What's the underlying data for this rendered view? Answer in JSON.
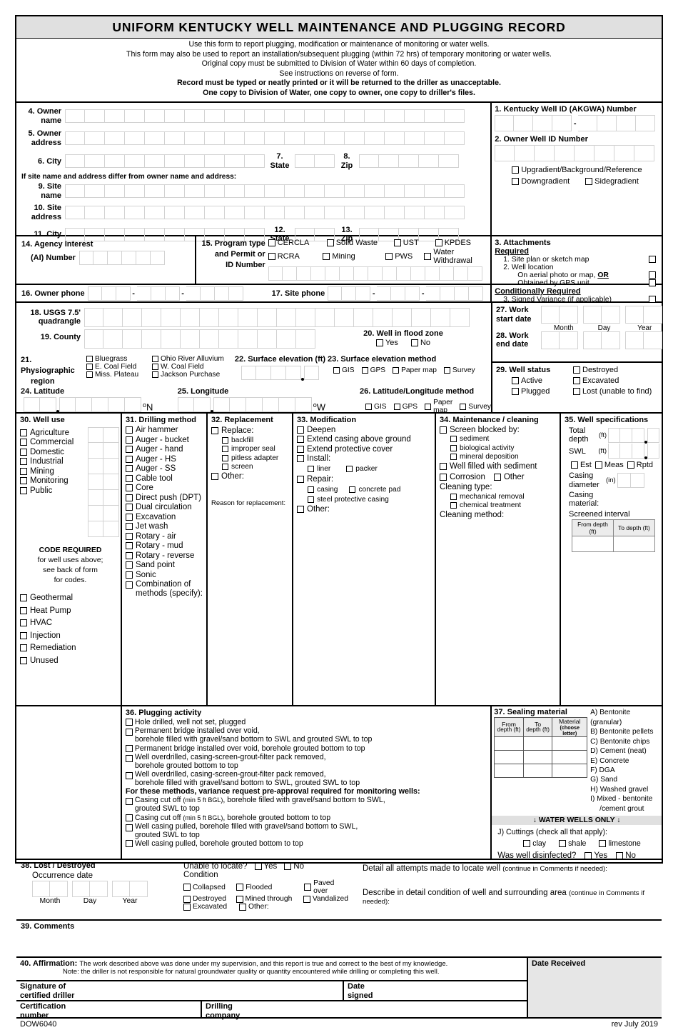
{
  "header": {
    "title": "UNIFORM KENTUCKY WELL MAINTENANCE AND PLUGGING RECORD",
    "lines": [
      "Use this form to report plugging, modification or maintenance of monitoring or water wells.",
      "This form may also be used to report an installation/subsequent plugging (within 72 hrs) of temporary monitoring or water wells.",
      "Original copy must be submitted to Division of Water within 60 days of completion.",
      "See instructions on reverse of form."
    ],
    "bold_lines": [
      "Record must be typed or neatly printed or it will be returned to the driller as unacceptable.",
      "One copy to Division of Water, one copy to owner, one copy to driller's files."
    ]
  },
  "owner": {
    "f4": "4. Owner",
    "f4b": "name",
    "f5": "5. Owner",
    "f5b": "address",
    "f6": "6. City",
    "f7": "7.",
    "f7b": "State",
    "f8": "8.",
    "f8b": "Zip",
    "note": "If site name and address differ from owner name and address:",
    "f9": "9. Site",
    "f9b": "name",
    "f10": "10. Site",
    "f10b": "address",
    "f11": "11. City",
    "f12": "12.",
    "f12b": "State",
    "f13": "13.",
    "f13b": "Zip"
  },
  "wellid": {
    "f1": "1.  Kentucky Well ID (AKGWA) Number",
    "f2": "2. Owner Well ID Number",
    "dash": "-",
    "gradients": [
      "Upgradient/Background/Reference",
      "Downgradient",
      "Sidegradient"
    ]
  },
  "attachments": {
    "title": "3. Attachments",
    "required": "Required",
    "item1": "1. Site plan or sketch map",
    "item2": "2. Well location",
    "item2a": "On aerial photo or map, ",
    "item2a_or": "OR",
    "item2b": "Obtained by GPS unit",
    "cond": "Conditionally Required",
    "item3": "3. Signed Variance (if applicable)"
  },
  "agency": {
    "f14": "14. Agency Interest",
    "f14b": "(AI) Number",
    "f15": "15. Program type",
    "f15b": "and Permit or",
    "f15c": "ID Number",
    "programs": [
      "CERCLA",
      "Solid Waste",
      "UST",
      "KPDES",
      "RCRA",
      "Mining",
      "PWS",
      "Water Withdrawal"
    ]
  },
  "phones": {
    "f16": "16. Owner phone",
    "f17": "17. Site phone",
    "dash": "-"
  },
  "location": {
    "f18": "18. USGS 7.5'",
    "f18b": "quadrangle",
    "f19": "19. County",
    "f20": "20. Well in flood zone",
    "yes": "Yes",
    "no": "No",
    "f21": "21. Physiographic",
    "f21b": "region",
    "regions": [
      "Bluegrass",
      "Ohio River Alluvium",
      "E. Coal Field",
      "W. Coal Field",
      "Miss. Plateau",
      "Jackson Purchase"
    ],
    "f22": "22. Surface elevation (ft)",
    "f23": "23. Surface elevation method",
    "f24": "24. Latitude",
    "f25": "25. Longitude",
    "f26": "26. Latitude/Longitude method",
    "methods": [
      "GIS",
      "GPS",
      "Paper map",
      "Survey"
    ],
    "degN": "N",
    "degW": "W",
    "deg": "o"
  },
  "work": {
    "f27": "27. Work",
    "f27b": "start date",
    "f28": "28. Work",
    "f28b": "end date",
    "month": "Month",
    "day": "Day",
    "year": "Year",
    "f29": "29. Well status",
    "status": [
      "Active",
      "Plugged",
      "Destroyed",
      "Excavated",
      "Lost (unable to find)"
    ]
  },
  "welluse": {
    "title": "30. Well use",
    "items": [
      "Agriculture",
      "Commercial",
      "Domestic",
      "Industrial",
      "Mining",
      "Monitoring",
      "Public"
    ],
    "code_l1": "CODE REQUIRED",
    "code_l2": "for well uses above;",
    "code_l3": "see back of form",
    "code_l4": "for codes.",
    "items2": [
      "Geothermal",
      "Heat Pump",
      "HVAC",
      "Injection",
      "Remediation",
      "Unused"
    ]
  },
  "drilling": {
    "title": "31. Drilling method",
    "items": [
      "Air hammer",
      "Auger - bucket",
      "Auger - hand",
      "Auger - HS",
      "Auger - SS",
      "Cable tool",
      "Core",
      "Direct push (DPT)",
      "Dual circulation",
      "Excavation",
      "Jet wash",
      "Rotary - air",
      "Rotary - mud",
      "Rotary - reverse",
      "Sand point",
      "Sonic"
    ],
    "combo_a": "Combination of",
    "combo_b": "methods (specify):"
  },
  "replacement": {
    "title": "32. Replacement",
    "replace": "Replace:",
    "subs": [
      "backfill",
      "improper seal",
      "pitless adapter",
      "screen"
    ],
    "other": "Other:",
    "reason": "Reason for replacement:"
  },
  "modification": {
    "title": "33. Modification",
    "deepen": "Deepen",
    "extend_casing": "Extend casing above ground",
    "extend_cover": "Extend protective cover",
    "install": "Install:",
    "install_subs": [
      "liner",
      "packer"
    ],
    "repair": "Repair:",
    "repair_subs": [
      "casing",
      "concrete pad"
    ],
    "repair_sub3": "steel protective casing",
    "other": "Other:"
  },
  "maintenance": {
    "title": "34. Maintenance / cleaning",
    "screen_blocked": "Screen blocked by:",
    "blocked_subs": [
      "sediment",
      "biological activity",
      "mineral deposition"
    ],
    "filled": "Well filled with sediment",
    "corrosion": "Corrosion",
    "other": "Other",
    "cleaning_type": "Cleaning type:",
    "cleaning_subs": [
      "mechanical removal",
      "chemical treatment"
    ],
    "cleaning_method": "Cleaning method:"
  },
  "specs": {
    "title": "35. Well specifications",
    "total_depth_a": "Total",
    "total_depth_b": "depth",
    "ft": "(ft)",
    "swl": "SWL",
    "swl_ft": "(ft)",
    "est": "Est",
    "meas": "Meas",
    "rptd": "Rptd",
    "casing_dia_a": "Casing",
    "casing_dia_b": "diameter",
    "in": "(in)",
    "casing_mat_a": "Casing",
    "casing_mat_b": "material:",
    "screened": "Screened interval",
    "from_depth": "From depth (ft)",
    "to_depth": "To depth (ft)"
  },
  "plugging": {
    "title": "36. Plugging activity",
    "items": [
      {
        "l1": "Hole drilled, well not set, plugged",
        "l2": ""
      },
      {
        "l1": "Permanent bridge installed over void,",
        "l2": "borehole filled with gravel/sand bottom to SWL and grouted SWL to top"
      },
      {
        "l1": "Permanent bridge installed over void, borehole grouted bottom to top",
        "l2": ""
      },
      {
        "l1": "Well overdrilled, casing-screen-grout-filter pack removed,",
        "l2": "borehole grouted bottom to top"
      },
      {
        "l1": "Well overdrilled, casing-screen-grout-filter pack removed,",
        "l2": "borehole filled with gravel/sand bottom to SWL, grouted SWL to top"
      }
    ],
    "variance_note": "For these methods, variance request pre-approval required for monitoring wells:",
    "items2": [
      {
        "a": "Casing cut off ",
        "small": "(min 5 ft BGL)",
        "b": ", borehole filled with gravel/sand bottom to SWL,",
        "l2": "grouted SWL to top"
      },
      {
        "a": "Casing cut off ",
        "small": "(min 5 ft BGL)",
        "b": ", borehole grouted bottom to top",
        "l2": ""
      },
      {
        "a": "Well casing pulled, borehole filled with gravel/sand bottom to SWL,",
        "small": "",
        "b": "",
        "l2": "grouted SWL to top"
      },
      {
        "a": "Well casing pulled, borehole grouted bottom to top",
        "small": "",
        "b": "",
        "l2": ""
      }
    ]
  },
  "sealing": {
    "title": "37. Sealing material",
    "col1_a": "From",
    "col1_b": "depth (ft)",
    "col2_a": "To",
    "col2_b": "depth (ft)",
    "col3_a": "Material",
    "col3_b": "(choose letter)",
    "legend": [
      "A) Bentonite (granular)",
      "B) Bentonite pellets",
      "C) Bentonite chips",
      "D) Cement (neat)",
      "E) Concrete",
      "F) DGA",
      "G) Sand",
      "H) Washed gravel",
      "I)  Mixed - bentonite",
      "/cement grout"
    ],
    "water_banner": "↓ WATER WELLS ONLY ↓",
    "cuttings": "J) Cuttings (check all that apply):",
    "cut_opts": [
      "clay",
      "shale",
      "limestone"
    ],
    "disinfected": "Was well disinfected?",
    "yes": "Yes",
    "no": "No"
  },
  "lost": {
    "title": "38. Lost / Destroyed",
    "occurrence": "Occurrence date",
    "month": "Month",
    "day": "Day",
    "year": "Year",
    "unable": "Unable to locate?",
    "yes": "Yes",
    "no": "No",
    "condition": "Condition",
    "cond_opts": [
      "Collapsed",
      "Flooded",
      "Paved over",
      "Destroyed",
      "Mined through",
      "Vandalized",
      "Excavated",
      "Other:"
    ],
    "detail_a": "Detail all attempts made to locate well ",
    "detail_small": "(continue in Comments if needed):",
    "describe_a": "Describe in detail condition of well and surrounding area ",
    "describe_small": "(continue in Comments if needed):"
  },
  "comments": {
    "title": "39. Comments"
  },
  "affirmation": {
    "title": "40. Affirmation:",
    "line1": "The work described above was done under my supervision, and this report is true and correct to the best of my knowledge.",
    "line2": "Note:  the driller is not responsible for natural groundwater quality or quantity encountered while drilling or completing this well.",
    "sig_a": "Signature of",
    "sig_b": "certified driller",
    "date_a": "Date",
    "date_b": "signed",
    "cert_a": "Certification",
    "cert_b": "number",
    "co_a": "Drilling",
    "co_b": "company",
    "date_received": "Date Received"
  },
  "footer": {
    "formnum": "DOW6040",
    "rev": "rev July 2019"
  }
}
